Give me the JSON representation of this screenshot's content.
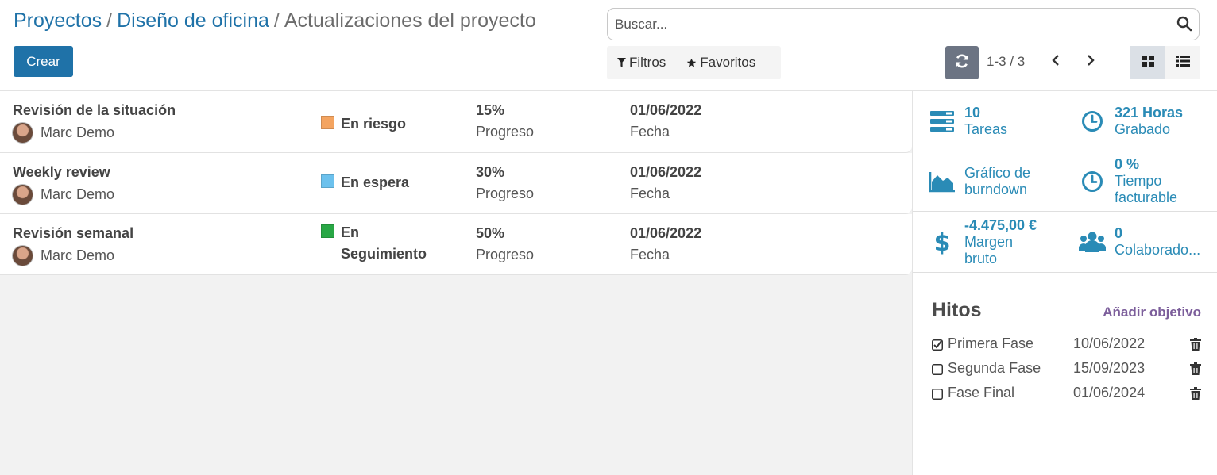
{
  "breadcrumb": {
    "items": [
      "Proyectos",
      "Diseño de oficina"
    ],
    "separator": "/",
    "current": "Actualizaciones del proyecto"
  },
  "search": {
    "placeholder": "Buscar..."
  },
  "toolbar": {
    "create_label": "Crear",
    "filters_label": "Filtros",
    "favorites_label": "Favoritos"
  },
  "pager": {
    "value": "1-3 / 3"
  },
  "colors": {
    "brand": "#1f72a8",
    "stat_text": "#2a8bb6",
    "accent_purple": "#7c5e9b",
    "status_at_risk": "#f4a460",
    "status_on_hold": "#6cc1ed",
    "status_on_track": "#28a745"
  },
  "updates": [
    {
      "title": "Revisión de la situación",
      "user": "Marc Demo",
      "status": "En riesgo",
      "status_color": "#f4a460",
      "progress": "15%",
      "progress_label": "Progreso",
      "date": "01/06/2022",
      "date_label": "Fecha"
    },
    {
      "title": "Weekly review",
      "user": "Marc Demo",
      "status": "En espera",
      "status_color": "#6cc1ed",
      "progress": "30%",
      "progress_label": "Progreso",
      "date": "01/06/2022",
      "date_label": "Fecha"
    },
    {
      "title": "Revisión semanal",
      "user": "Marc Demo",
      "status": "En Seguimiento",
      "status_color": "#28a745",
      "progress": "50%",
      "progress_label": "Progreso",
      "date": "01/06/2022",
      "date_label": "Fecha"
    }
  ],
  "stats": [
    {
      "icon": "tasks-icon",
      "value": "10",
      "label": "Tareas",
      "label2": ""
    },
    {
      "icon": "clock-icon",
      "value": "321 Horas",
      "label": "Grabado",
      "label2": ""
    },
    {
      "icon": "area-chart-icon",
      "value": "",
      "label": "Gráfico de",
      "label2": "burndown"
    },
    {
      "icon": "clock-icon",
      "value": "0 %",
      "label": "Tiempo",
      "label2": "facturable"
    },
    {
      "icon": "dollar-icon",
      "value": "-4.475,00 €",
      "label": "Margen",
      "label2": "bruto"
    },
    {
      "icon": "users-icon",
      "value": "0",
      "label": "Colaborado...",
      "label2": ""
    }
  ],
  "milestones": {
    "title": "Hitos",
    "add_label": "Añadir objetivo",
    "items": [
      {
        "name": "Primera Fase",
        "date": "10/06/2022",
        "done": true
      },
      {
        "name": "Segunda Fase",
        "date": "15/09/2023",
        "done": false
      },
      {
        "name": "Fase Final",
        "date": "01/06/2024",
        "done": false
      }
    ]
  }
}
